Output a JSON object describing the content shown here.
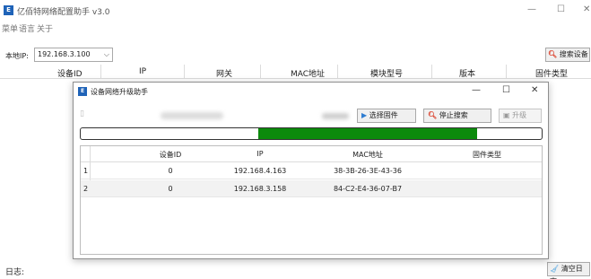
{
  "window": {
    "title": "亿佰特网络配置助手 v3.0",
    "icon_text": "E",
    "controls": [
      "—",
      "☐",
      "✕"
    ]
  },
  "menu": [
    "菜单",
    "语言",
    "关于"
  ],
  "toolbar": {
    "local_ip_label": "本地IP:",
    "local_ip_value": "192.168.3.100",
    "search_button": "搜索设备"
  },
  "columns": [
    "设备ID",
    "IP",
    "网关",
    "MAC地址",
    "模块型号",
    "版本",
    "固件类型"
  ],
  "log": {
    "label": "日志:",
    "clear_button": "清空日志"
  },
  "dialog": {
    "title": "设备网络升级助手",
    "icon_text": "E",
    "controls": [
      "—",
      "☐",
      "✕"
    ],
    "select_firmware_button": "选择固件",
    "stop_search_button": "停止搜索",
    "upgrade_button": "升级",
    "progress": {
      "start": 0.385,
      "end": 0.86,
      "color": "#0c8a0c"
    },
    "table": {
      "columns": [
        "设备ID",
        "IP",
        "MAC地址",
        "固件类型"
      ],
      "rows": [
        {
          "num": "1",
          "device_id": "0",
          "ip": "192.168.4.163",
          "mac": "38-3B-26-3E-43-36",
          "fw_type": ""
        },
        {
          "num": "2",
          "device_id": "0",
          "ip": "192.168.3.158",
          "mac": "84-C2-E4-36-07-B7",
          "fw_type": ""
        }
      ]
    }
  },
  "colors": {
    "brand": "#1f63b8",
    "progress": "#0c8a0c",
    "search_icon": "#d9301a"
  }
}
